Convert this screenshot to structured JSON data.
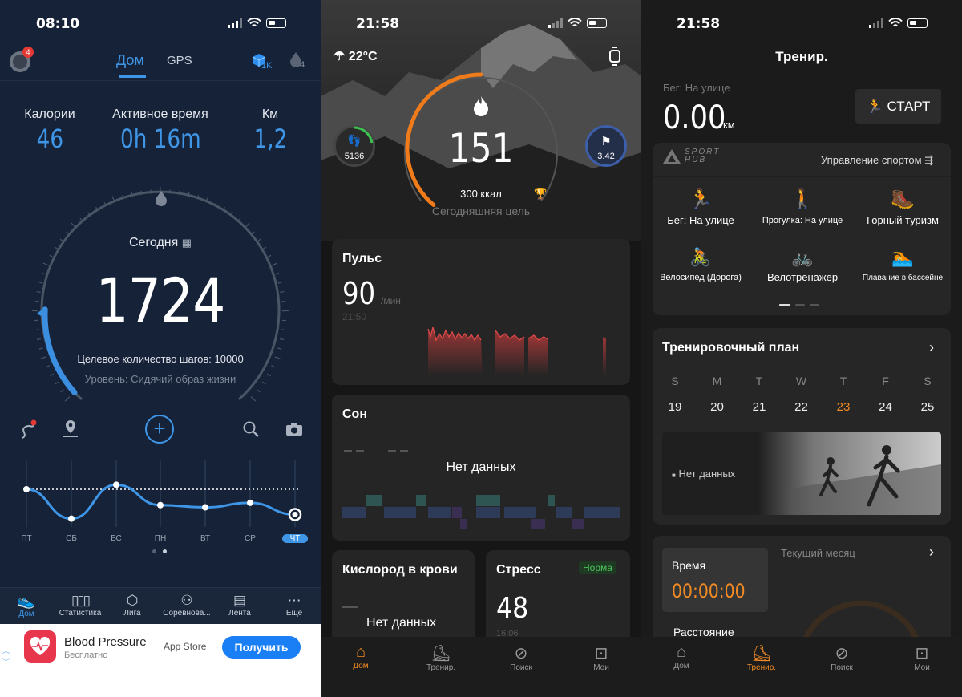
{
  "left": {
    "status_time": "08:10",
    "badge_count": "4",
    "tabs": [
      "Дом",
      "GPS"
    ],
    "cube_count": "1K",
    "drop_count": "4",
    "stats": [
      {
        "label": "Калории",
        "value": "46"
      },
      {
        "label": "Активное время",
        "value": "0h 16m"
      },
      {
        "label": "Км",
        "value": "1,2"
      }
    ],
    "today_label": "Сегодня",
    "steps": "1724",
    "goal_text": "Целевое количество шагов: 10000",
    "level_text": "Уровень: Сидячий образ жизни",
    "goal_progress": 0.17,
    "week_days": [
      "ПТ",
      "СБ",
      "ВС",
      "ПН",
      "ВТ",
      "СР",
      "ЧТ"
    ],
    "week_values": [
      1,
      0.22,
      1.12,
      0.58,
      0.52,
      0.64,
      0.33
    ],
    "nav": [
      "Дом",
      "Статистика",
      "Лига",
      "Соревнова...",
      "Лента",
      "Еще"
    ],
    "ad": {
      "title": "Blood Pressure",
      "subtitle": "Бесплатно",
      "store": "App Store",
      "button": "Получить"
    }
  },
  "middle": {
    "status_time": "21:58",
    "weather": "22°C",
    "steps": "5136",
    "calories": "151",
    "km": "3.42",
    "goal_kcal": "300 ккал",
    "goal_label": "Сегодняшняя цель",
    "calorie_progress": 0.5,
    "pulse": {
      "title": "Пульс",
      "value": "90",
      "unit": "/мин",
      "time": "21:50"
    },
    "sleep": {
      "title": "Сон",
      "nodata": "Нет данных"
    },
    "oxygen": {
      "title": "Кислород в крови",
      "nodata": "Нет данных"
    },
    "stress": {
      "title": "Стресс",
      "badge": "Норма",
      "value": "48",
      "time": "16:06"
    },
    "nav": [
      "Дом",
      "Тренир.",
      "Поиск",
      "Мои"
    ]
  },
  "right": {
    "status_time": "21:58",
    "title": "Тренир.",
    "activity_label": "Бег: На улице",
    "distance": "0.00",
    "distance_unit": "км",
    "start_button": "СТАРТ",
    "brand_top": "SPORT",
    "brand_bottom": "HUB",
    "manage_label": "Управление спортом",
    "sports": [
      "Бег: На улице",
      "Прогулка: На улице",
      "Горный туризм",
      "Велосипед (Дорога)",
      "Велотренажер",
      "Плавание в бассейне"
    ],
    "plan_title": "Тренировочный план",
    "weekdays": [
      "S",
      "M",
      "T",
      "W",
      "T",
      "F",
      "S"
    ],
    "dates": [
      "19",
      "20",
      "21",
      "22",
      "23",
      "24",
      "25"
    ],
    "today_date": "23",
    "plan_nodata": "Нет данных",
    "time_label": "Время",
    "time_value": "00:00:00",
    "distance_label": "Расстояние",
    "month_label": "Текущий месяц",
    "nav": [
      "Дом",
      "Тренир.",
      "Поиск",
      "Мои"
    ]
  }
}
